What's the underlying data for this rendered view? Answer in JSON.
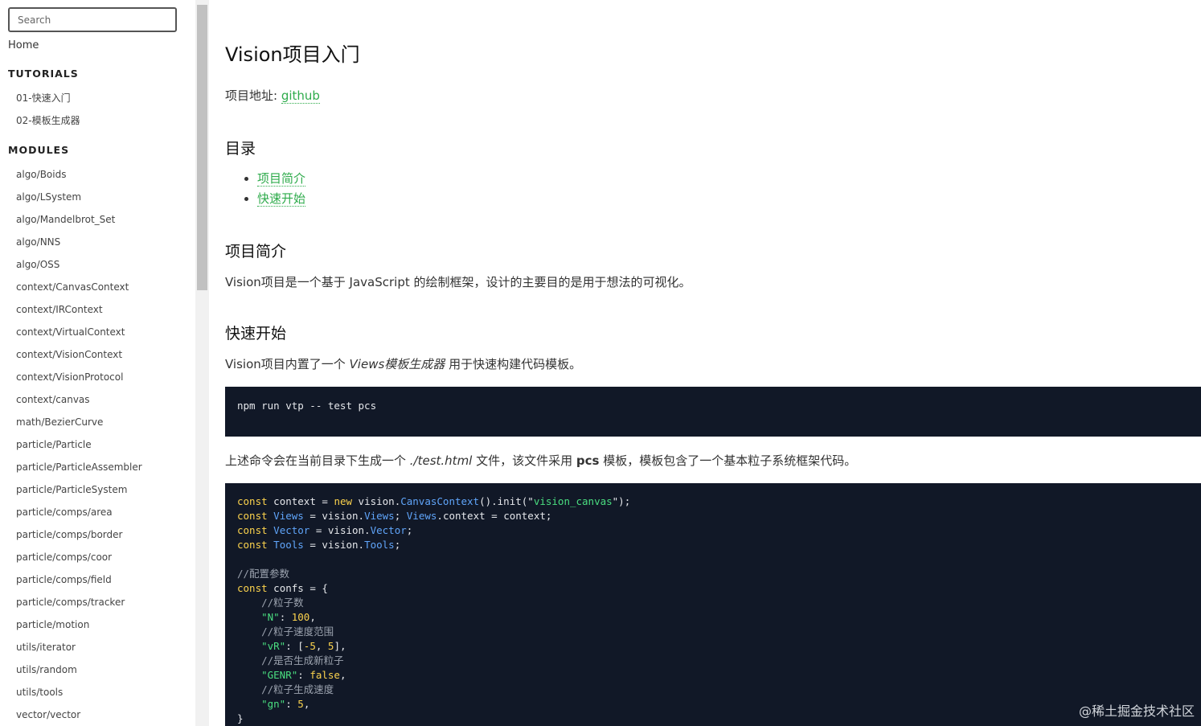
{
  "search": {
    "placeholder": "Search"
  },
  "sidebar": {
    "home": "Home",
    "tutorials_title": "TUTORIALS",
    "tutorials": [
      "01-快速入门",
      "02-模板生成器"
    ],
    "modules_title": "MODULES",
    "modules": [
      "algo/Boids",
      "algo/LSystem",
      "algo/Mandelbrot_Set",
      "algo/NNS",
      "algo/OSS",
      "context/CanvasContext",
      "context/IRContext",
      "context/VirtualContext",
      "context/VisionContext",
      "context/VisionProtocol",
      "context/canvas",
      "math/BezierCurve",
      "particle/Particle",
      "particle/ParticleAssembler",
      "particle/ParticleSystem",
      "particle/comps/area",
      "particle/comps/border",
      "particle/comps/coor",
      "particle/comps/field",
      "particle/comps/tracker",
      "particle/motion",
      "utils/iterator",
      "utils/random",
      "utils/tools",
      "vector/vector"
    ]
  },
  "main": {
    "title": "Vision项目入门",
    "project_url_label": "项目地址: ",
    "project_url_link": "github",
    "toc_heading": "目录",
    "toc": [
      "项目简介",
      "快速开始"
    ],
    "intro_heading": "项目简介",
    "intro_text": "Vision项目是一个基于 JavaScript 的绘制框架，设计的主要目的是用于想法的可视化。",
    "quick_heading": "快速开始",
    "quick_text_pre": "Vision项目内置了一个 ",
    "quick_text_em": "Views模板生成器",
    "quick_text_post": " 用于快速构建代码模板。",
    "command": "npm run vtp -- test pcs",
    "after_pre": "上述命令会在当前目录下生成一个 ",
    "after_em": "./test.html",
    "after_mid": " 文件，该文件采用 ",
    "after_b": "pcs",
    "after_post": " 模板，模板包含了一个基本粒子系统框架代码。",
    "code": {
      "kw_const": "const",
      "kw_new": "new",
      "ctx_var": " context = ",
      "vision": "vision.",
      "canvas_ctx": "CanvasContext",
      "init_open": "().init(\"",
      "canvas_str": "vision_canvas",
      "init_close": "\");",
      "views": "Views",
      "eq_vision": " = vision.",
      "views_assign": "; ",
      "views_ctx": ".context = context;",
      "vector": "Vector",
      "tools": "Tools",
      "semi": ";",
      "comment_config": "//配置参数",
      "confs_open": " confs = {",
      "comment_n": "//粒子数",
      "key_n": "\"N\"",
      "val_n": "100",
      "comment_vr": "//粒子速度范围",
      "key_vr": "\"vR\"",
      "val_vr_a": "-5",
      "val_vr_b": "5",
      "comment_genr": "//是否生成新粒子",
      "key_genr": "\"GENR\"",
      "val_genr": "false",
      "comment_gn": "//粒子生成速度",
      "key_gn": "\"gn\"",
      "val_gn": "5",
      "close": "}"
    }
  },
  "watermark": "@稀土掘金技术社区"
}
